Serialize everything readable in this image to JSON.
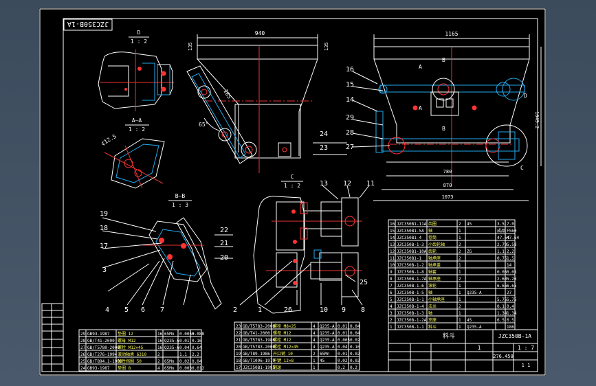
{
  "drawing": {
    "stamp": "JZC350B-1A",
    "views": {
      "d_title": "D",
      "d_scale": "1 : 2",
      "aa_title": "A—A",
      "aa_scale": "1 : 2",
      "bb_title": "B—B",
      "bb_scale": "1 : 3",
      "c_title": "C",
      "c_scale": "1 : 2"
    },
    "dims": {
      "top_940": "940",
      "top_1165": "1165",
      "left_135": "135",
      "right_135": "135",
      "dim_165": "165",
      "dim_65": "65°",
      "dim_125": "¢12.5",
      "dim_780": "780",
      "dim_870": "870",
      "dim_1073": "1073",
      "dim_vert": "1049.2"
    },
    "callouts": [
      "1",
      "2",
      "3",
      "4",
      "5",
      "6",
      "7",
      "8",
      "9",
      "10",
      "11",
      "12",
      "13",
      "14",
      "15",
      "16",
      "17",
      "18",
      "19",
      "20",
      "21",
      "22",
      "23",
      "24",
      "25",
      "26",
      "27",
      "28",
      "29"
    ],
    "letters": {
      "A": "A",
      "B": "B",
      "C": "C",
      "D": "D"
    },
    "bom_right": [
      [
        "16",
        "JZC350B1-11A",
        "齿圈",
        "2",
        "45",
        "3.5",
        "7.0"
      ],
      [
        "15",
        "JZC350B1-5A",
        "轴",
        "1",
        "",
        "成品",
        "FS60"
      ],
      [
        "14",
        "JZC350B1-4",
        "卷筒",
        "1",
        "",
        "47.64",
        "47.64"
      ],
      [
        "13",
        "JZC350B-1-3",
        "小齿轮轴",
        "2",
        "",
        "2.79",
        "5.58"
      ],
      [
        "12",
        "JZC350B1-10A",
        "齿轮",
        "2",
        "ZG",
        "1.1",
        "2.2"
      ],
      [
        "11",
        "JZC350B1-1",
        "轴承座",
        "2",
        "",
        "0.75",
        "1.5"
      ],
      [
        "10",
        "JZC350B-1-2",
        "轴承盖",
        "1",
        "",
        "",
        "14"
      ],
      [
        "9",
        "JZC350B-1-8",
        "轴套",
        "1",
        "",
        "0.05",
        "0.05"
      ],
      [
        "8",
        "JZC350B-1-7A",
        "轴承座",
        "2",
        "",
        "2.63",
        "5.26"
      ],
      [
        "7",
        "JZC350B-1-6",
        "滚轮",
        "1",
        "",
        "6.65",
        "6.65"
      ],
      [
        "6",
        "JZC350B-1-5",
        "轴",
        "1",
        "Q235-A",
        "",
        "27"
      ],
      [
        "5",
        "JZC350B-1-1",
        "小轴承座",
        "1",
        "",
        "5.75",
        "5.75"
      ],
      [
        "4",
        "JZC350B-1-4",
        "法兰",
        "2",
        "",
        "0.1",
        "0.4"
      ],
      [
        "3",
        "JZC350B-1-3",
        "轴",
        "1",
        "",
        "1.34",
        "1.34"
      ],
      [
        "2",
        "JZC350B-1-2A",
        "支座",
        "1",
        "45",
        "6.5",
        "6.5"
      ],
      [
        "1",
        "JZC350B-1-1",
        "料斗",
        "1",
        "Q235-A",
        "",
        "186"
      ]
    ],
    "bom_left": [
      [
        "29",
        "GB93-1987",
        "垫圈 12",
        "16",
        "65Mn",
        "0.0055",
        "0.088"
      ],
      [
        "28",
        "GB/T41-2000",
        "螺母 M12",
        "16",
        "Q235-A",
        "0.01",
        "0.16"
      ],
      [
        "27",
        "GB/T5780-2000",
        "螺栓 M12×45",
        "16",
        "Q235-A",
        "0.04",
        "0.64"
      ],
      [
        "26",
        "GB/T276-1994",
        "滚动轴承 6310",
        "2",
        "",
        "1.1",
        "2.2"
      ],
      [
        "25",
        "GB/T894.1-1986",
        "弹性挡圈 50",
        "2",
        "65Mn",
        "0.02",
        "0.04"
      ],
      [
        "24",
        "GB93-1987",
        "垫圈 8",
        "4",
        "65Mn",
        "0.003",
        "0.012"
      ]
    ],
    "bom_mid": [
      [
        "23",
        "GB/T5783-2000",
        "螺栓 M8×25",
        "4",
        "Q235-A",
        "0.01",
        "0.04"
      ],
      [
        "22",
        "GB/T41-2000",
        "螺母 M12",
        "4",
        "Q235-A",
        "0.01",
        "0.04"
      ],
      [
        "21",
        "GB/T5783-1986",
        "螺栓 M12",
        "4",
        "Q235-A",
        "0.005",
        "0.02"
      ],
      [
        "20",
        "GB/T5783-2000",
        "螺栓 M12×45",
        "4",
        "Q235-A",
        "0.04",
        "0.16"
      ],
      [
        "19",
        "GB/T89-1986",
        "开口销 10",
        "2",
        "65Mn",
        "0.01",
        "0.02"
      ],
      [
        "18",
        "GB/T1096-1979",
        "平键 12×8",
        "1",
        "45",
        "0.02",
        "0.02"
      ],
      [
        "17",
        "JZC350B1-1995",
        "钢球",
        "1",
        "",
        "0.2",
        "0.2"
      ]
    ],
    "title_block": {
      "name": "料斗",
      "code": "JZC350B-1A",
      "qty": "1",
      "scale": "1 : 7",
      "weight": "276.458",
      "sheet": "1 1"
    }
  }
}
